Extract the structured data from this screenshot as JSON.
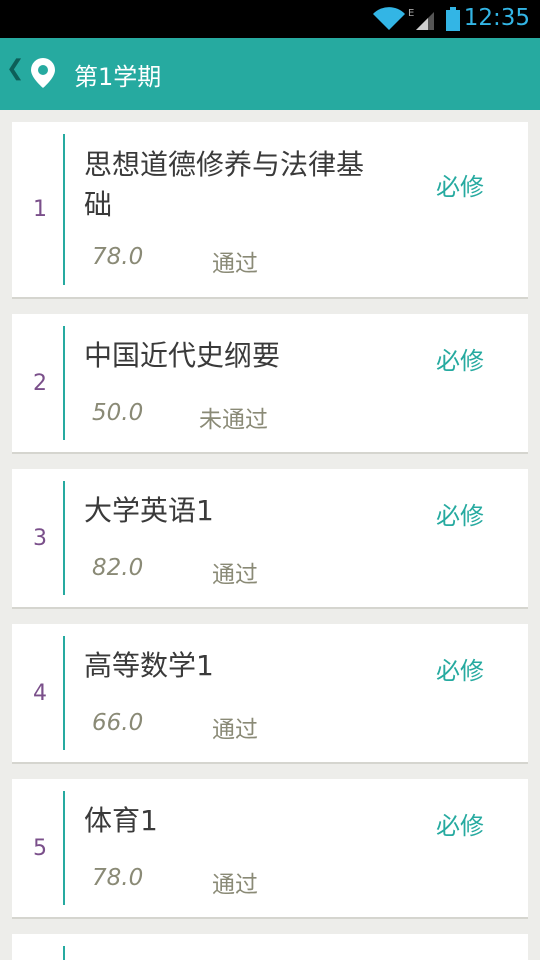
{
  "status_bar": {
    "time": "12:35",
    "network_label": "E",
    "icons": [
      "wifi-icon",
      "signal-icon",
      "battery-icon"
    ]
  },
  "app_bar": {
    "back_icon": "chevron-left-icon",
    "logo_icon": "map-pin-icon",
    "title": "第1学期"
  },
  "colors": {
    "accent": "#26aaa0",
    "index": "#7a4f8a",
    "muted": "#8a8a76",
    "background": "#ededea"
  },
  "courses": [
    {
      "index": "1",
      "name": "思想道德修养与法律基础",
      "type": "必修",
      "score": "78.0",
      "result": "通过"
    },
    {
      "index": "2",
      "name": "中国近代史纲要",
      "type": "必修",
      "score": "50.0",
      "result": "未通过"
    },
    {
      "index": "3",
      "name": "大学英语1",
      "type": "必修",
      "score": "82.0",
      "result": "通过"
    },
    {
      "index": "4",
      "name": "高等数学1",
      "type": "必修",
      "score": "66.0",
      "result": "通过"
    },
    {
      "index": "5",
      "name": "体育1",
      "type": "必修",
      "score": "78.0",
      "result": "通过"
    }
  ]
}
